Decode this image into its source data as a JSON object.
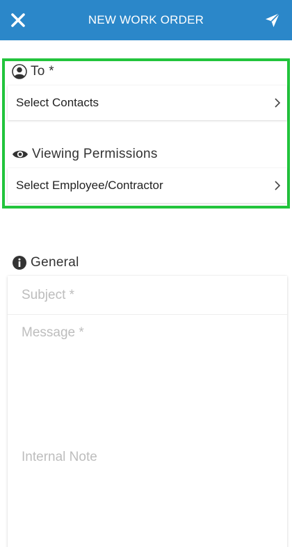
{
  "header": {
    "title": "NEW WORK ORDER",
    "background_color": "#2b87c9",
    "close_icon": "close-icon",
    "send_icon": "send-icon"
  },
  "recipients": {
    "highlight_color": "#22c43c",
    "to": {
      "icon": "person-icon",
      "label": "To *",
      "select_label": "Select Contacts",
      "chevron": "›"
    },
    "viewing_permissions": {
      "icon": "eye-icon",
      "label": "Viewing Permissions",
      "select_label": "Select Employee/Contractor",
      "chevron": "›"
    }
  },
  "general": {
    "icon": "info-icon",
    "label": "General",
    "subject_placeholder": "Subject *",
    "message_placeholder": "Message *",
    "internal_note_placeholder": "Internal Note"
  }
}
